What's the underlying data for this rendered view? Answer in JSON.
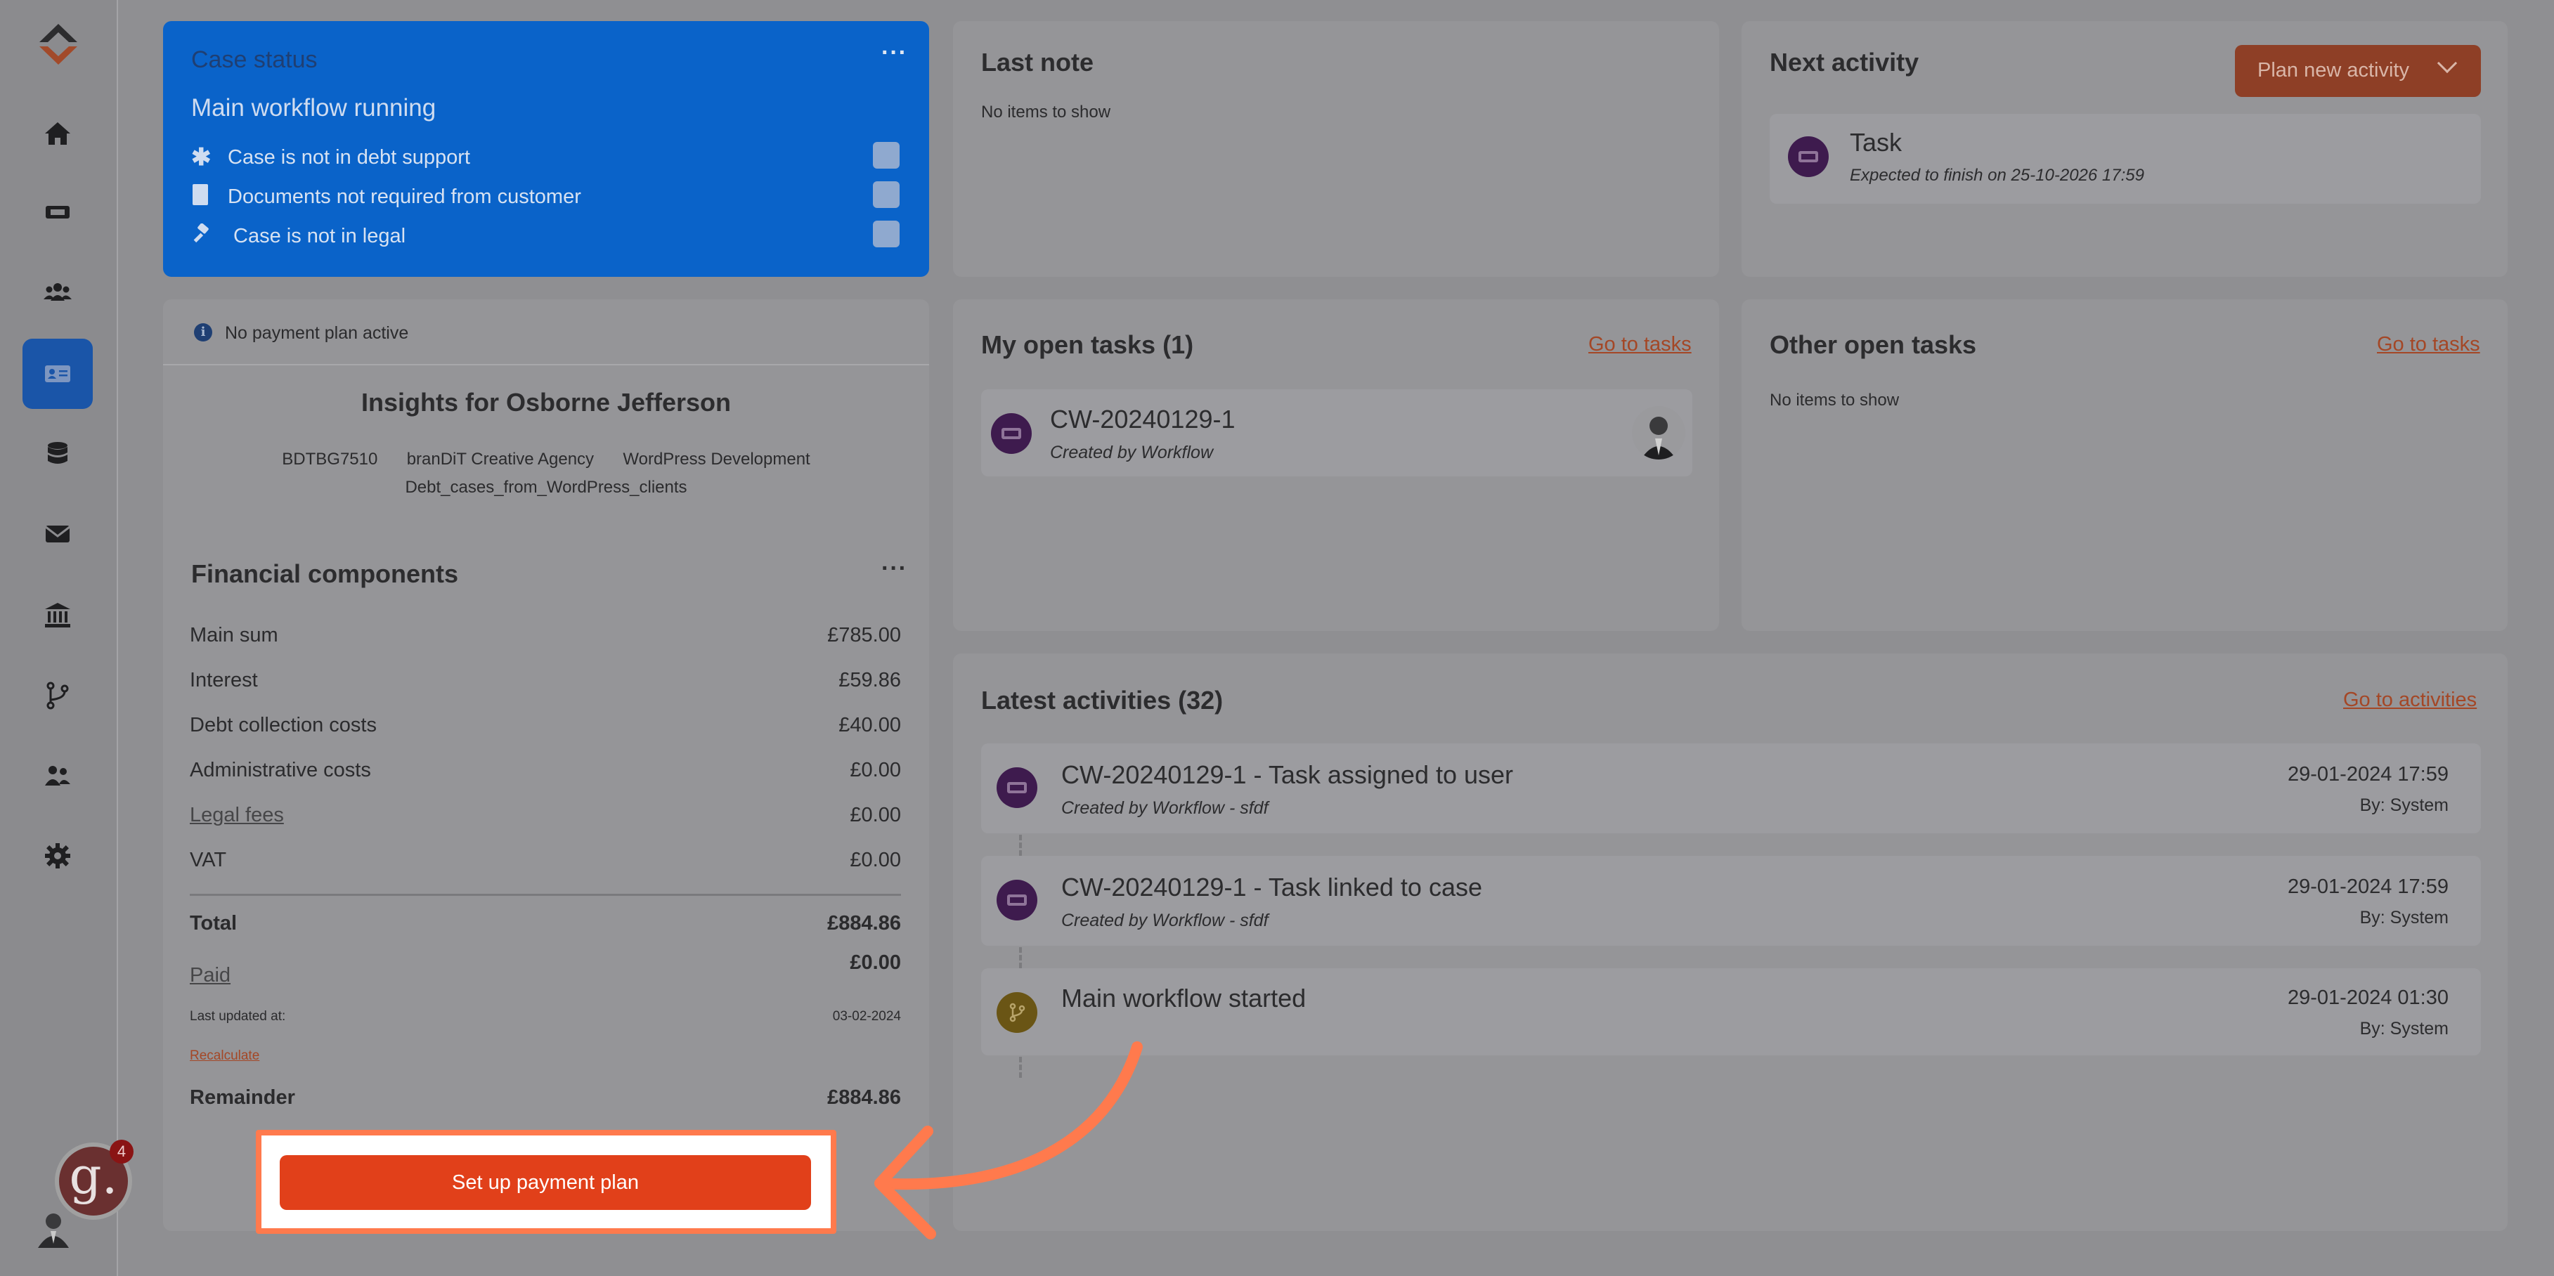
{
  "sidebar": {
    "items": [
      "home-icon",
      "ticket-icon",
      "users-icon",
      "id-card-icon",
      "database-icon",
      "mail-icon",
      "bank-icon",
      "branch-icon",
      "user-group-icon",
      "gear-icon"
    ],
    "active_index": 3,
    "notification_count": "4"
  },
  "case_status": {
    "title": "Case status",
    "subtitle": "Main workflow running",
    "items": [
      {
        "icon": "asterisk-icon",
        "label": "Case is not in debt support"
      },
      {
        "icon": "document-icon",
        "label": "Documents not required from customer"
      },
      {
        "icon": "gavel-icon",
        "label": "Case is not in legal"
      }
    ]
  },
  "last_note": {
    "title": "Last note",
    "empty": "No items to show"
  },
  "next_activity": {
    "title": "Next activity",
    "plan_button": "Plan new activity",
    "task_title": "Task",
    "task_sub": "Expected to finish on 25-10-2026 17:59"
  },
  "insights": {
    "notice": "No payment plan active",
    "title": "Insights for Osborne Jefferson",
    "tags": [
      "BDTBG7510",
      "branDiT Creative Agency",
      "WordPress Development",
      "Debt_cases_from_WordPress_clients"
    ]
  },
  "financial": {
    "title": "Financial components",
    "rows": [
      {
        "label": "Main sum",
        "value": "£785.00"
      },
      {
        "label": "Interest",
        "value": "£59.86"
      },
      {
        "label": "Debt collection costs",
        "value": "£40.00"
      },
      {
        "label": "Administrative costs",
        "value": "£0.00"
      },
      {
        "label": "Legal fees",
        "value": "£0.00"
      },
      {
        "label": "VAT",
        "value": "£0.00"
      }
    ],
    "total_label": "Total",
    "total_value": "£884.86",
    "paid_label": "Paid",
    "paid_value": "£0.00",
    "updated_label": "Last updated at:",
    "updated_value": "03-02-2024",
    "recalculate": "Recalculate",
    "remainder_label": "Remainder",
    "remainder_value": "£884.86",
    "cta": "Set up payment plan"
  },
  "my_tasks": {
    "title": "My open tasks (1)",
    "link": "Go to tasks",
    "task_id": "CW-20240129-1",
    "task_sub": "Created by Workflow"
  },
  "other_tasks": {
    "title": "Other open tasks",
    "link": "Go to tasks",
    "empty": "No items to show"
  },
  "activities": {
    "title": "Latest activities (32)",
    "link": "Go to activities",
    "items": [
      {
        "title": "CW-20240129-1 - Task assigned to user",
        "sub": "Created by Workflow - sfdf",
        "date": "29-01-2024 17:59",
        "by": "By: System"
      },
      {
        "title": "CW-20240129-1 - Task linked to case",
        "sub": "Created by Workflow - sfdf",
        "date": "29-01-2024 17:59",
        "by": "By: System"
      },
      {
        "title": "Main workflow started",
        "sub": "",
        "date": "29-01-2024 01:30",
        "by": "By: System"
      }
    ]
  },
  "colors": {
    "accent": "#e1401a",
    "highlight": "#ff7a4d",
    "status_blue": "#0a63c9"
  }
}
